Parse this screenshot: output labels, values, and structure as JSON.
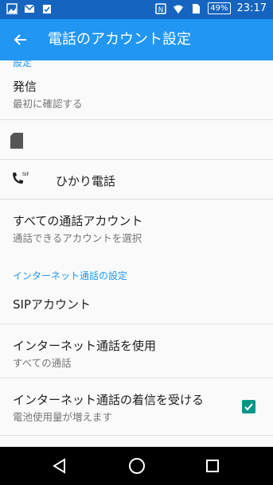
{
  "status_bar": {
    "battery": "49%",
    "time": "23:17",
    "icons_left": [
      "image-icon",
      "mail-icon",
      "clipboard-check-icon"
    ],
    "icons_right": [
      "nfc-icon",
      "wifi-icon",
      "sim-icon",
      "battery-icon"
    ]
  },
  "app_bar": {
    "title": "電話のアカウント設定"
  },
  "settings": {
    "cut_header": "設定",
    "calls": {
      "title": "発信",
      "summary": "最初に確認する"
    },
    "sip_account": {
      "title": "ひかり電話"
    },
    "all_accounts": {
      "title": "すべての通話アカウント",
      "summary": "通話できるアカウントを選択"
    },
    "internet_header": "インターネット通話の設定",
    "sip_accounts": {
      "title": "SIPアカウント"
    },
    "use_internet": {
      "title": "インターネット通話を使用",
      "summary": "すべての通話"
    },
    "receive_internet": {
      "title": "インターネット通話の着信を受ける",
      "summary": "電池使用量が増えます",
      "checked": true
    }
  },
  "colors": {
    "status_bar": "#1565c0",
    "app_bar": "#2196f3",
    "accent": "#2196f3",
    "checkbox": "#009688"
  }
}
